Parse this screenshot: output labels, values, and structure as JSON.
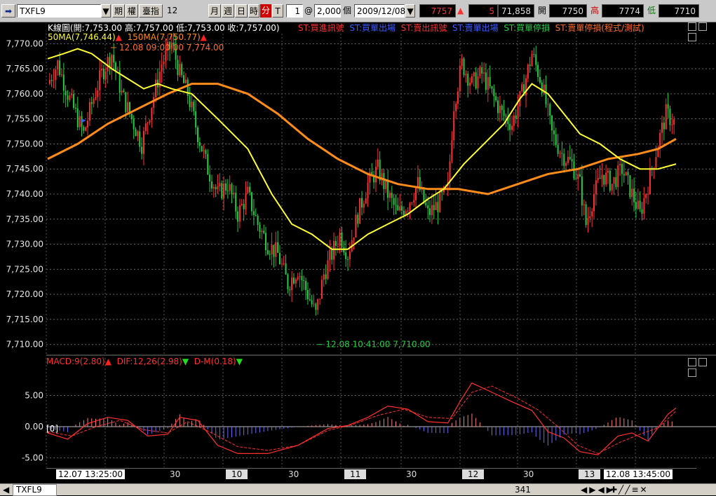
{
  "toolbar": {
    "symbol": "TXFL9",
    "type_futures": "期",
    "type_options": "權",
    "type_index": "臺指",
    "period_value": "12",
    "period_month": "月",
    "period_week": "週",
    "period_day": "日",
    "period_hour": "時",
    "period_minute": "分",
    "period_tick": "T",
    "count_value": "1",
    "at_symbol": "@",
    "bars_value": "2,000",
    "bars_unit": "個",
    "date_value": "2009/12/08",
    "last_price": "7757",
    "change": "5",
    "volume": "71,858",
    "open_label": "開",
    "open_value": "7750",
    "high_label": "高",
    "high_value": "7774",
    "low_label": "低",
    "low_value": "7710"
  },
  "price_header": {
    "ohlc": "K線圖(開:7,753.00 高:7,757.00 低:7,753.00 收:7,757.00)",
    "legends": [
      "ST:買進訊號",
      "ST:買單出場",
      "ST:賣出訊號",
      "ST:賣單出場",
      "ST:買單停損",
      "ST:賣單停損(程式/測試)"
    ],
    "ma50": "50MA(7,746.44)",
    "ma150": "150MA(7,750.77)",
    "high_annotation": "12.08 09:00:00  7,774.00",
    "low_annotation": "12.08 10:41:00  7,710.00"
  },
  "macd_header": {
    "macd": "MACD:9(2.80)",
    "dif": "DIF:12,26(2.98)",
    "dm": "D-M(0.18)",
    "zero_tag": "[0]"
  },
  "x_axis": {
    "labels": [
      "12.07 13:25:00",
      "30",
      "10",
      "30",
      "11",
      "30",
      "12",
      "30",
      "13",
      "12.08 13:45:00"
    ]
  },
  "status": {
    "tab": "TXFL9",
    "count": "341"
  },
  "chart_data": [
    {
      "type": "candlestick",
      "title": "K線圖",
      "ylim": [
        7708,
        7772
      ],
      "y_ticks": [
        7770,
        7765,
        7760,
        7755,
        7750,
        7745,
        7740,
        7735,
        7730,
        7725,
        7720,
        7715,
        7710
      ],
      "y_tick_labels": [
        "7,770.00",
        "7,765.00",
        "7,760.00",
        "7,755.00",
        "7,750.00",
        "7,745.00",
        "7,740.00",
        "7,735.00",
        "7,730.00",
        "7,725.00",
        "7,720.00",
        "7,715.00",
        "7,710.00"
      ],
      "close_path": [
        [
          0,
          7762
        ],
        [
          5,
          7766
        ],
        [
          10,
          7760
        ],
        [
          14,
          7756
        ],
        [
          18,
          7752
        ],
        [
          22,
          7758
        ],
        [
          27,
          7764
        ],
        [
          32,
          7768
        ],
        [
          37,
          7760
        ],
        [
          42,
          7755
        ],
        [
          47,
          7750
        ],
        [
          52,
          7758
        ],
        [
          57,
          7766
        ],
        [
          62,
          7770
        ],
        [
          66,
          7764
        ],
        [
          70,
          7760
        ],
        [
          75,
          7752
        ],
        [
          80,
          7745
        ],
        [
          85,
          7740
        ],
        [
          90,
          7742
        ],
        [
          95,
          7736
        ],
        [
          100,
          7740
        ],
        [
          105,
          7734
        ],
        [
          110,
          7730
        ],
        [
          115,
          7728
        ],
        [
          120,
          7722
        ],
        [
          125,
          7725
        ],
        [
          130,
          7720
        ],
        [
          134,
          7716
        ],
        [
          138,
          7724
        ],
        [
          142,
          7728
        ],
        [
          146,
          7732
        ],
        [
          150,
          7728
        ],
        [
          155,
          7736
        ],
        [
          160,
          7742
        ],
        [
          165,
          7745
        ],
        [
          170,
          7740
        ],
        [
          175,
          7736
        ],
        [
          180,
          7738
        ],
        [
          185,
          7742
        ],
        [
          190,
          7736
        ],
        [
          195,
          7738
        ],
        [
          200,
          7741
        ],
        [
          203,
          7758
        ],
        [
          207,
          7766
        ],
        [
          212,
          7762
        ],
        [
          217,
          7764
        ],
        [
          222,
          7760
        ],
        [
          227,
          7756
        ],
        [
          232,
          7754
        ],
        [
          237,
          7760
        ],
        [
          242,
          7768
        ],
        [
          247,
          7762
        ],
        [
          252,
          7752
        ],
        [
          257,
          7748
        ],
        [
          262,
          7746
        ],
        [
          266,
          7742
        ],
        [
          269,
          7734
        ],
        [
          273,
          7740
        ],
        [
          277,
          7744
        ],
        [
          282,
          7742
        ],
        [
          287,
          7745
        ],
        [
          292,
          7740
        ],
        [
          296,
          7736
        ],
        [
          300,
          7742
        ],
        [
          305,
          7750
        ],
        [
          309,
          7756
        ],
        [
          314,
          7754
        ]
      ],
      "ma50_path": [
        [
          0,
          7767
        ],
        [
          8,
          7768
        ],
        [
          15,
          7769
        ],
        [
          22,
          7768
        ],
        [
          32,
          7765
        ],
        [
          40,
          7763
        ],
        [
          48,
          7761
        ],
        [
          55,
          7762
        ],
        [
          62,
          7761
        ],
        [
          72,
          7760
        ],
        [
          85,
          7755
        ],
        [
          100,
          7749
        ],
        [
          112,
          7740
        ],
        [
          122,
          7734
        ],
        [
          132,
          7732
        ],
        [
          142,
          7729
        ],
        [
          150,
          7729
        ],
        [
          160,
          7732
        ],
        [
          170,
          7734
        ],
        [
          180,
          7736
        ],
        [
          190,
          7739
        ],
        [
          198,
          7741
        ],
        [
          208,
          7746
        ],
        [
          218,
          7750
        ],
        [
          228,
          7754
        ],
        [
          236,
          7759
        ],
        [
          242,
          7762
        ],
        [
          250,
          7760
        ],
        [
          258,
          7756
        ],
        [
          266,
          7752
        ],
        [
          276,
          7750
        ],
        [
          286,
          7747
        ],
        [
          296,
          7745
        ],
        [
          305,
          7745
        ],
        [
          314,
          7746
        ]
      ],
      "ma150_path": [
        [
          0,
          7747
        ],
        [
          15,
          7750
        ],
        [
          30,
          7754
        ],
        [
          45,
          7757
        ],
        [
          60,
          7760
        ],
        [
          72,
          7762
        ],
        [
          85,
          7762
        ],
        [
          100,
          7760
        ],
        [
          115,
          7756
        ],
        [
          130,
          7751
        ],
        [
          145,
          7747
        ],
        [
          160,
          7744
        ],
        [
          175,
          7742
        ],
        [
          190,
          7741
        ],
        [
          205,
          7741
        ],
        [
          220,
          7740
        ],
        [
          235,
          7742
        ],
        [
          250,
          7744
        ],
        [
          265,
          7745
        ],
        [
          280,
          7747
        ],
        [
          295,
          7748
        ],
        [
          305,
          7749
        ],
        [
          314,
          7751
        ]
      ],
      "high_point": [
        62,
        7774
      ],
      "low_point": [
        134,
        7710
      ]
    },
    {
      "type": "bar",
      "title": "MACD",
      "ylim": [
        -6.5,
        11
      ],
      "y_ticks": [
        5,
        0,
        -5
      ],
      "y_tick_labels": [
        "5.00",
        "0.00",
        "-5.00"
      ],
      "dif_path": [
        [
          0,
          -1
        ],
        [
          10,
          -2
        ],
        [
          20,
          0.5
        ],
        [
          30,
          1.5
        ],
        [
          40,
          1
        ],
        [
          50,
          -1.5
        ],
        [
          60,
          -1.2
        ],
        [
          66,
          1.5
        ],
        [
          75,
          1
        ],
        [
          85,
          -3
        ],
        [
          95,
          -4.3
        ],
        [
          110,
          -4.3
        ],
        [
          125,
          -3
        ],
        [
          140,
          -0.3
        ],
        [
          150,
          0.2
        ],
        [
          160,
          1.5
        ],
        [
          170,
          3.3
        ],
        [
          180,
          2.8
        ],
        [
          190,
          0.8
        ],
        [
          200,
          0.6
        ],
        [
          206,
          4
        ],
        [
          212,
          7
        ],
        [
          222,
          5.5
        ],
        [
          232,
          4
        ],
        [
          242,
          2.6
        ],
        [
          250,
          -0.8
        ],
        [
          258,
          -1.8
        ],
        [
          266,
          -4
        ],
        [
          275,
          -4.5
        ],
        [
          285,
          -1.5
        ],
        [
          292,
          -1
        ],
        [
          300,
          -2.3
        ],
        [
          310,
          2
        ],
        [
          314,
          3
        ]
      ],
      "dem_path": [
        [
          0,
          -0.8
        ],
        [
          12,
          -1.5
        ],
        [
          24,
          0
        ],
        [
          36,
          1
        ],
        [
          48,
          -0.5
        ],
        [
          60,
          -1
        ],
        [
          70,
          0.8
        ],
        [
          82,
          -1
        ],
        [
          95,
          -3.2
        ],
        [
          110,
          -3.8
        ],
        [
          125,
          -3
        ],
        [
          140,
          -0.6
        ],
        [
          152,
          0.3
        ],
        [
          165,
          1.8
        ],
        [
          178,
          2.8
        ],
        [
          190,
          1.5
        ],
        [
          202,
          1.3
        ],
        [
          212,
          5.5
        ],
        [
          222,
          6.5
        ],
        [
          235,
          4.5
        ],
        [
          245,
          2.7
        ],
        [
          255,
          0
        ],
        [
          265,
          -3
        ],
        [
          275,
          -4.3
        ],
        [
          286,
          -2.5
        ],
        [
          296,
          -1.2
        ],
        [
          305,
          -0.2
        ],
        [
          314,
          2.5
        ]
      ]
    }
  ]
}
